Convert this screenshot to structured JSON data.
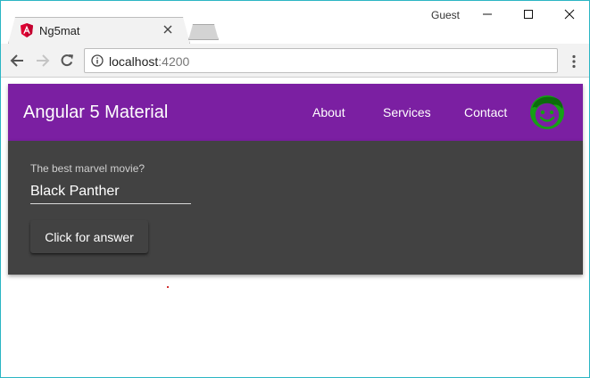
{
  "browser": {
    "tab_title": "Ng5mat",
    "tab_favicon": "angular-logo-icon",
    "profile_label": "Guest",
    "url_host": "localhost",
    "url_port": ":4200"
  },
  "app": {
    "title": "Angular 5 Material",
    "nav": {
      "about": "About",
      "services": "Services",
      "contact": "Contact"
    },
    "avatar_icon": "smiley-face-icon"
  },
  "form": {
    "field_label": "The best marvel movie?",
    "field_value": "Black Panther",
    "button_label": "Click for answer"
  },
  "colors": {
    "primary": "#7b1fa2",
    "card": "#424242",
    "avatar": "#16a016",
    "window_border": "#2bb5c4"
  }
}
